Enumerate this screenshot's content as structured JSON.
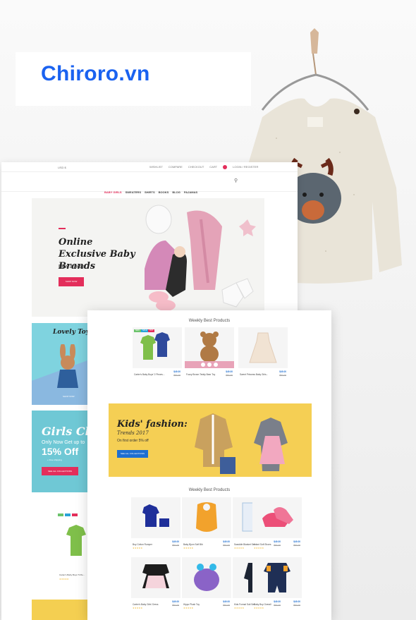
{
  "watermark": {
    "text": "Chiroro.vn",
    "color": "#1a62f0"
  },
  "back_page": {
    "topbar": {
      "currency": "USD $",
      "links": [
        "WISHLIST",
        "COMPARE",
        "CHECKOUT",
        "CART",
        "LOGIN / REGISTER"
      ],
      "cart_count": "0"
    },
    "nav": [
      "BABY GIRLS",
      "SWEATERS",
      "SHIRTS",
      "BOOKS",
      "BLOG",
      "PAJAMAS"
    ],
    "hero": {
      "title": "Online Exclusive Baby Brands",
      "subtitle": "New arrivals",
      "button": "SHOP NOW"
    },
    "card_toys": {
      "title": "Lovely Toys",
      "button": "SHOP NOW"
    },
    "card_girls": {
      "title": "Girls Clothes",
      "line": "Only Now Get up to",
      "percent": "15% Off",
      "shipping": "+ Free shipping",
      "button": "SEE ALL COLLECTIONS"
    }
  },
  "front_page": {
    "section1_title": "Weekly Best Products",
    "section2_title": "Weekly Best Products",
    "banner": {
      "title": "Kids' fashion:",
      "subtitle": "Trends 2017",
      "offer": "On first order 5% off",
      "button": "SEE ALL COLLECTIONS"
    },
    "row1": [
      {
        "name": "Carter's Baby Boys' 2 Pieces...",
        "price": "$49.00",
        "old": "$57.00",
        "cat": "BABY"
      },
      {
        "name": "Fuzzy Brown Teddy Bear Toy",
        "price": "$49.00",
        "old": "$57.00",
        "cat": "TOYS"
      },
      {
        "name": "Sweet Princess Baby Girls...",
        "price": "$49.00",
        "old": "$57.00",
        "cat": "GIRLS"
      }
    ],
    "row2": [
      {
        "name": "Boy Cotton Romper",
        "price": "$49.00",
        "old": "$57.00",
        "cat": "BABY"
      },
      {
        "name": "Baby Bjorn Soft Bib",
        "price": "$49.00",
        "old": "$57.00",
        "cat": "ACCESS"
      },
      {
        "name": "Swaddle Blanket Set",
        "price": "$49.00",
        "old": "$57.00",
        "cat": "BABY"
      },
      {
        "name": "Infant Soft Shoes",
        "price": "$49.00",
        "old": "$57.00",
        "cat": "SHOES"
      }
    ],
    "row3": [
      {
        "name": "Carter's Baby Girls' Dress",
        "price": "$49.00",
        "old": "$57.00",
        "cat": "GIRLS"
      },
      {
        "name": "Hippo Plush Toy",
        "price": "$49.00",
        "old": "$57.00",
        "cat": "TOYS"
      },
      {
        "name": "Kids Formal Suit Set",
        "price": "$49.00",
        "old": "$57.00",
        "cat": "BOYS"
      },
      {
        "name": "Baby Boy Overall",
        "price": "$49.00",
        "old": "$57.00",
        "cat": "BABY"
      }
    ]
  }
}
